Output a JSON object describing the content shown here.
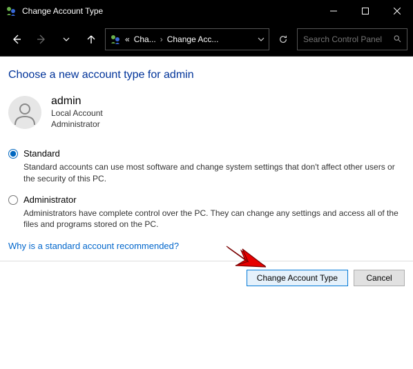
{
  "window": {
    "title": "Change Account Type"
  },
  "addressbar": {
    "bc_prefix": "«",
    "bc1": "Cha...",
    "bc2": "Change Acc...",
    "search_placeholder": "Search Control Panel"
  },
  "content": {
    "heading": "Choose a new account type for admin",
    "account": {
      "name": "admin",
      "line1": "Local Account",
      "line2": "Administrator"
    },
    "options": {
      "standard": {
        "label": "Standard",
        "desc": "Standard accounts can use most software and change system settings that don't affect other users or the security of this PC."
      },
      "admin": {
        "label": "Administrator",
        "desc": "Administrators have complete control over the PC. They can change any settings and access all of the files and programs stored on the PC."
      }
    },
    "help_link": "Why is a standard account recommended?"
  },
  "footer": {
    "primary": "Change Account Type",
    "cancel": "Cancel"
  }
}
